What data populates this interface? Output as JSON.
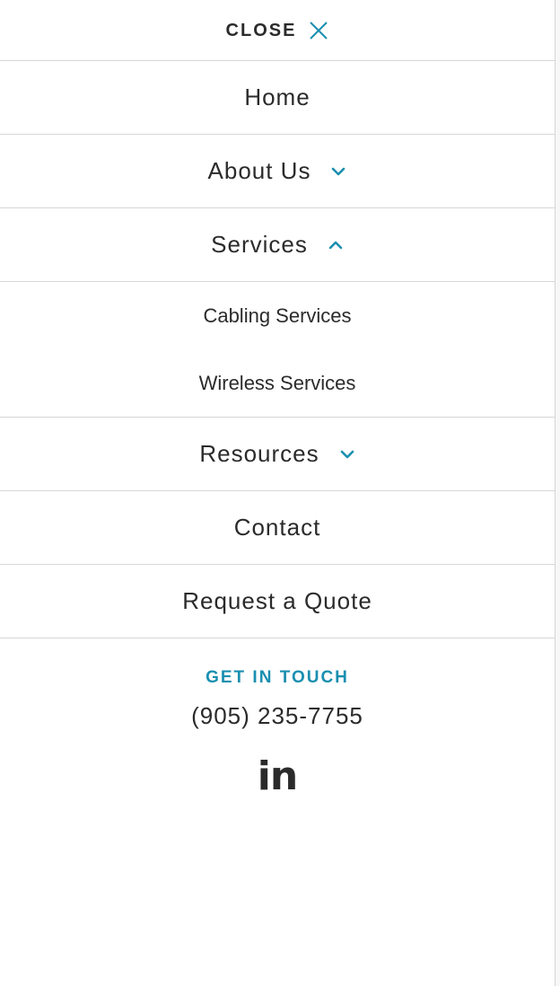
{
  "colors": {
    "accent": "#1a8fb0",
    "text": "#2b2b2b",
    "divider": "#d7d7d7",
    "background": "#ffffff"
  },
  "header": {
    "close_label": "CLOSE",
    "close_icon": "close-x-icon"
  },
  "nav": {
    "home": "Home",
    "about": "About Us",
    "services": "Services",
    "services_sub": [
      "Cabling Services",
      "Wireless Services"
    ],
    "resources": "Resources",
    "contact": "Contact",
    "quote": "Request a Quote"
  },
  "contact": {
    "heading": "GET IN TOUCH",
    "phone": "(905) 235-7755",
    "social": "in",
    "social_icon": "linkedin-icon"
  }
}
